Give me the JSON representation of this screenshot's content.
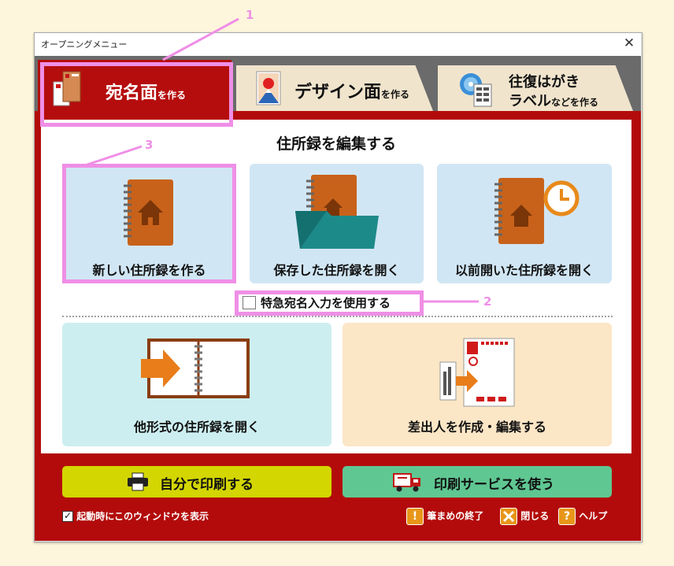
{
  "window": {
    "title": "オープニングメニュー",
    "close_glyph": "✕"
  },
  "tabs": [
    {
      "main": "宛名面",
      "suffix": "を作る"
    },
    {
      "main": "デザイン面",
      "suffix": "を作る"
    },
    {
      "line1": "往復はがき",
      "line2_main": "ラベル",
      "line2_suffix": "などを作る"
    }
  ],
  "section_title": "住所録を編集する",
  "cards": {
    "new": "新しい住所録を作る",
    "open_saved": "保存した住所録を開く",
    "open_recent": "以前開いた住所録を開く",
    "open_other": "他形式の住所録を開く",
    "sender": "差出人を作成・編集する"
  },
  "quick_entry": {
    "label": "特急宛名入力を使用する",
    "checked": false
  },
  "buttons": {
    "print_self": "自分で印刷する",
    "print_service": "印刷サービスを使う"
  },
  "footer": {
    "startup_label": "起動時にこのウィンドウを表示",
    "startup_checked": true,
    "exit_label": "筆まめの終了",
    "exit_glyph": "!",
    "close_label": "閉じる",
    "help_label": "ヘルプ",
    "help_glyph": "?"
  },
  "annotations": [
    "1",
    "2",
    "3"
  ],
  "colors": {
    "frame_red": "#b30b0b",
    "tab_inactive": "#f0e4cd",
    "card_blue": "#d1e6f4",
    "card_teal": "#cdeef0",
    "card_peach": "#fbe6c6",
    "print_yellow": "#d3d600",
    "print_green": "#5fc792",
    "highlight_pink": "#ef8fe6",
    "book_orange": "#c8621a",
    "icon_orange": "#e88a1a"
  }
}
